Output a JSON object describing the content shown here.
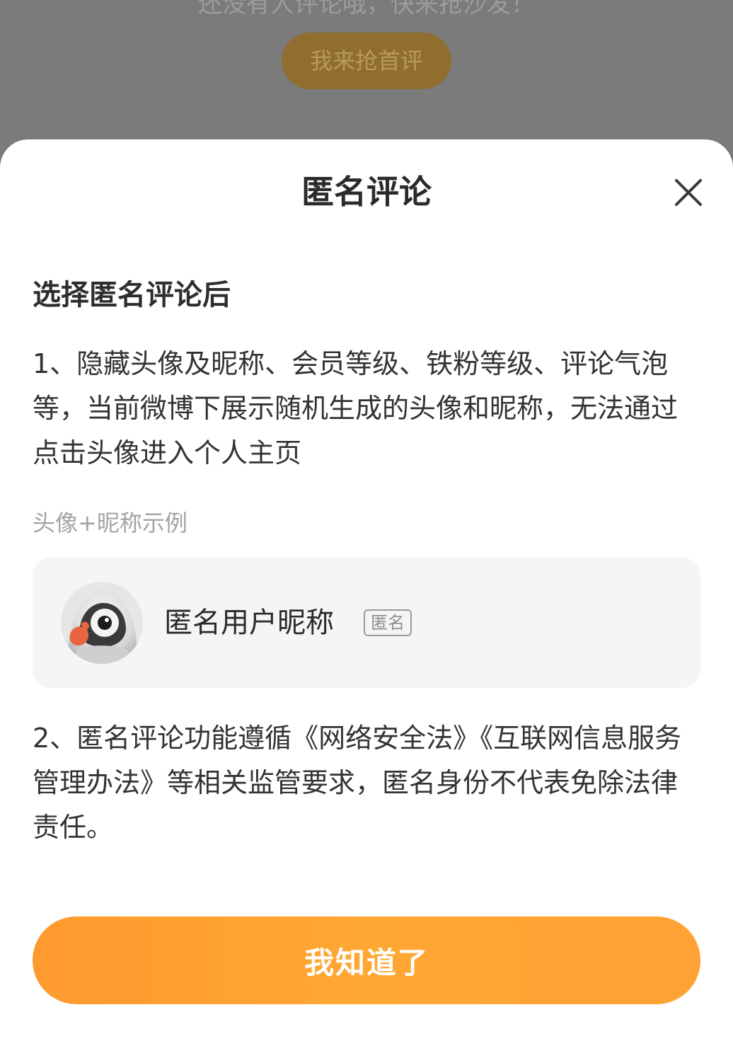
{
  "background": {
    "hint_text": "还没有人评论哦，快来抢沙发！",
    "first_comment_button": "我来抢首评"
  },
  "sheet": {
    "title": "匿名评论",
    "close_icon": "close-icon",
    "section_heading": "选择匿名评论后",
    "paragraph_1": "1、隐藏头像及昵称、会员等级、铁粉等级、评论气泡等，当前微博下展示随机生成的头像和昵称，无法通过点击头像进入个人主页",
    "example_label": "头像+昵称示例",
    "example": {
      "avatar_icon": "anonymous-avatar",
      "nickname": "匿名用户昵称",
      "badge": "匿名"
    },
    "paragraph_2": "2、匿名评论功能遵循《网络安全法》《互联网信息服务管理办法》等相关监管要求，匿名身份不代表免除法律责任。",
    "confirm_button": "我知道了"
  },
  "colors": {
    "accent": "#ffa233",
    "overlay": "#7b7b7b",
    "card_bg": "#f5f5f5"
  }
}
